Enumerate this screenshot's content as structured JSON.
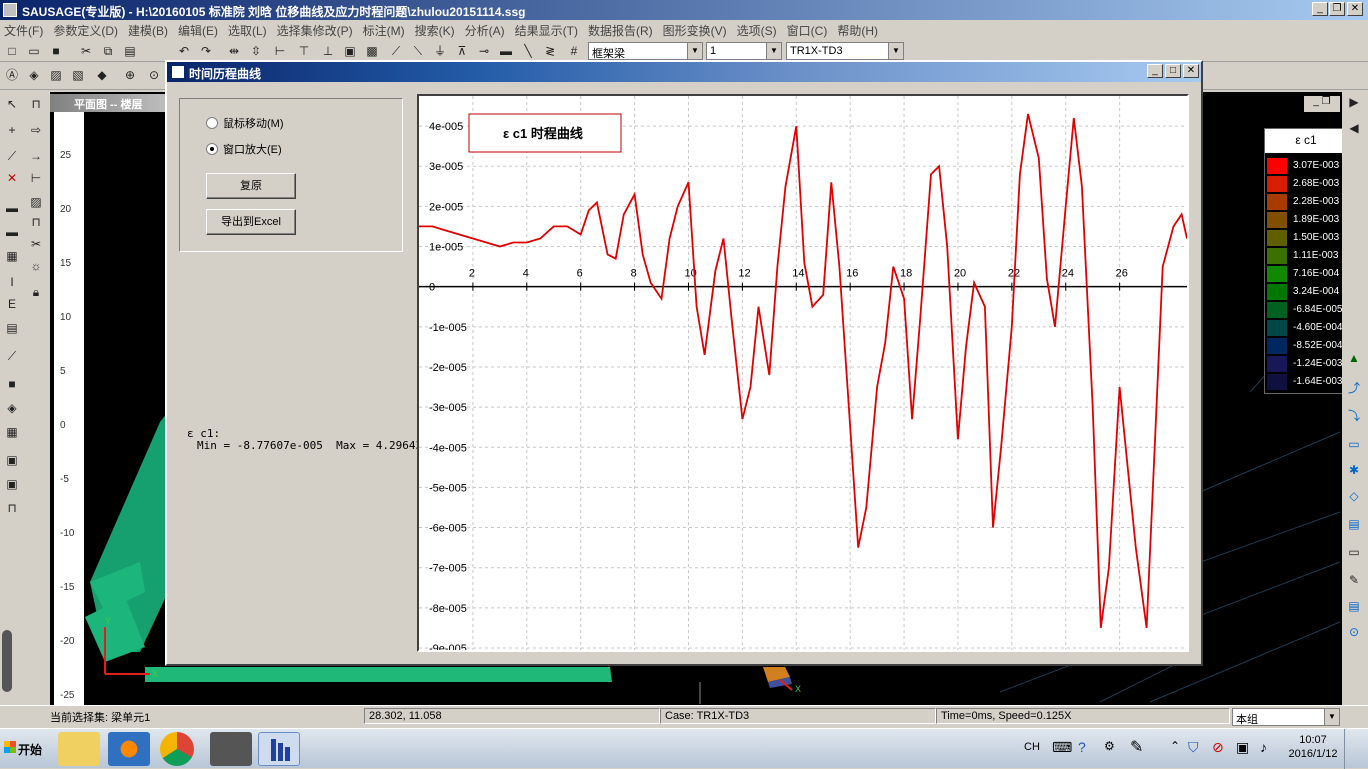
{
  "app": {
    "title": "SAUSAGE(专业版) - H:\\20160105 标准院 刘晗 位移曲线及应力时程问题\\zhulou20151114.ssg"
  },
  "menu": [
    "文件(F)",
    "参数定义(D)",
    "建模(B)",
    "编辑(E)",
    "选取(L)",
    "选择集修改(P)",
    "标注(M)",
    "搜索(K)",
    "分析(A)",
    "结果显示(T)",
    "数据报告(R)",
    "图形变换(V)",
    "选项(S)",
    "窗口(C)",
    "帮助(H)"
  ],
  "toolbar": {
    "combo1": "框架梁",
    "combo2": "1",
    "combo3": "TR1X-TD3"
  },
  "cad": {
    "window_title": "平面图 -- 楼层",
    "ruler_labels": [
      "25",
      "20",
      "15",
      "10",
      "5",
      "0",
      "-5",
      "-10",
      "-15",
      "-20",
      "-25"
    ],
    "axis_x": "X",
    "axis_y": "Y"
  },
  "legend": {
    "title": "ε c1",
    "items": [
      {
        "value": "3.07E-003",
        "color": "#ff0000"
      },
      {
        "value": "2.68E-003",
        "color": "#d81c00"
      },
      {
        "value": "2.28E-003",
        "color": "#a83c00"
      },
      {
        "value": "1.89E-003",
        "color": "#805000"
      },
      {
        "value": "1.50E-003",
        "color": "#606000"
      },
      {
        "value": "1.11E-003",
        "color": "#3c7000"
      },
      {
        "value": "7.16E-004",
        "color": "#108800"
      },
      {
        "value": "3.24E-004",
        "color": "#007800"
      },
      {
        "value": "-6.84E-005",
        "color": "#006020"
      },
      {
        "value": "-4.60E-004",
        "color": "#004848"
      },
      {
        "value": "-8.52E-004",
        "color": "#002860"
      },
      {
        "value": "-1.24E-003",
        "color": "#181858"
      },
      {
        "value": "-1.64E-003",
        "color": "#101040"
      }
    ]
  },
  "dialog": {
    "title": "时间历程曲线",
    "radio_move": "鼠标移动(M)",
    "radio_zoom": "窗口放大(E)",
    "btn_restore": "复原",
    "btn_export": "导出到Excel",
    "stat_label": "ε c1:",
    "stat_values": "Min = -8.77607e-005  Max = 4.29643e"
  },
  "chart_data": {
    "type": "line",
    "title": "ε c1 时程曲线",
    "xlabel": "",
    "ylabel": "",
    "xlim": [
      0,
      28.5
    ],
    "ylim": [
      -9e-05,
      4.5e-05
    ],
    "x_ticks": [
      2,
      4,
      6,
      8,
      10,
      12,
      14,
      16,
      18,
      20,
      22,
      24,
      26
    ],
    "y_ticks": [
      "4e-005",
      "3e-005",
      "2e-005",
      "1e-005",
      "0",
      "-1e-005",
      "-2e-005",
      "-3e-005",
      "-4e-005",
      "-5e-005",
      "-6e-005",
      "-7e-005",
      "-8e-005",
      "-9e-005"
    ],
    "grid": true,
    "color": "#e00000",
    "series": [
      {
        "x": [
          0,
          0.5,
          1,
          1.5,
          2,
          2.5,
          3,
          3.5,
          4,
          4.5,
          5,
          5.5,
          6,
          6.3,
          6.6,
          7,
          7.3,
          7.6,
          8,
          8.3,
          8.6,
          9,
          9.3,
          9.6,
          10,
          10.3,
          10.6,
          11,
          11.3,
          11.6,
          12,
          12.3,
          12.6,
          13,
          13.3,
          13.6,
          14,
          14.3,
          14.6,
          15,
          15.3,
          15.6,
          16,
          16.3,
          16.6,
          17,
          17.3,
          17.6,
          18,
          18.3,
          18.6,
          19,
          19.3,
          19.6,
          20,
          20.3,
          20.6,
          21,
          21.3,
          21.6,
          22,
          22.3,
          22.6,
          23,
          23.3,
          23.6,
          24,
          24.3,
          24.6,
          25,
          25.3,
          25.6,
          26,
          26.3,
          26.6,
          27,
          27.3,
          27.6,
          28,
          28.3,
          28.5
        ],
        "y": [
          1.5e-05,
          1.5e-05,
          1.4e-05,
          1.3e-05,
          1.2e-05,
          1.1e-05,
          1e-05,
          1.1e-05,
          1.1e-05,
          1.2e-05,
          1.5e-05,
          1.5e-05,
          1.3e-05,
          1.9e-05,
          2.1e-05,
          8e-06,
          7e-06,
          1.8e-05,
          2.3e-05,
          8e-06,
          1e-06,
          -3e-06,
          1.2e-05,
          2e-05,
          2.6e-05,
          -5e-06,
          -1.7e-05,
          4e-06,
          1.2e-05,
          -8e-06,
          -3.3e-05,
          -2.5e-05,
          -5e-06,
          -2.2e-05,
          5e-06,
          2.5e-05,
          4e-05,
          6e-06,
          -5e-06,
          -2e-06,
          2.6e-05,
          5e-06,
          -3.5e-05,
          -6.5e-05,
          -5.5e-05,
          -2.5e-05,
          -1.4e-05,
          5e-06,
          -3e-06,
          -3.3e-05,
          -8e-06,
          2.8e-05,
          3e-05,
          1e-05,
          -3.8e-05,
          -1.5e-05,
          1e-06,
          -5e-06,
          -6e-05,
          -4e-05,
          -1e-05,
          2.8e-05,
          4.3e-05,
          3.2e-05,
          2e-06,
          -1e-05,
          2e-05,
          4.2e-05,
          2.5e-05,
          -3e-05,
          -8.5e-05,
          -7e-05,
          -2.5e-05,
          -4.5e-05,
          -6.5e-05,
          -8.5e-05,
          -4e-05,
          5e-06,
          1.5e-05,
          1.8e-05,
          1.2e-05
        ]
      }
    ]
  },
  "status": {
    "selection": "当前选择集:  梁单元1",
    "coords": "28.302, 11.058",
    "case": "Case: TR1X-TD3",
    "time": "Time=0ms, Speed=0.125X",
    "group": "本组"
  },
  "taskbar": {
    "start": "开始",
    "lang": "CH",
    "time": "10:07",
    "date": "2016/1/12"
  }
}
